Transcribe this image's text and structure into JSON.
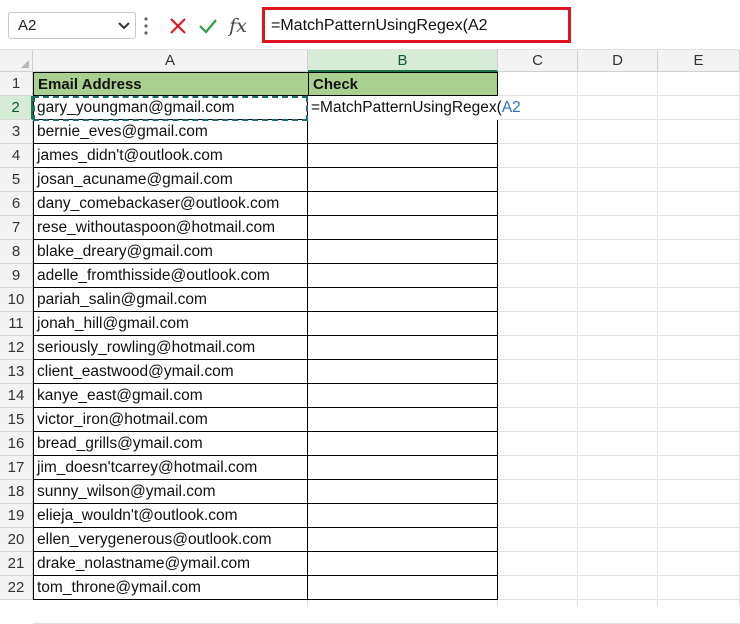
{
  "formula_bar": {
    "name_box": "A2",
    "formula": "=MatchPatternUsingRegex(A2",
    "fx_label": "fx"
  },
  "columns": [
    "A",
    "B",
    "C",
    "D",
    "E"
  ],
  "rows": [
    "1",
    "2",
    "3",
    "4",
    "5",
    "6",
    "7",
    "8",
    "9",
    "10",
    "11",
    "12",
    "13",
    "14",
    "15",
    "16",
    "17",
    "18",
    "19",
    "20",
    "21",
    "22"
  ],
  "table": {
    "header_a": "Email Address",
    "header_b": "Check",
    "emails": [
      "gary_youngman@gmail.com",
      "bernie_eves@gmail.com",
      "james_didn't@outlook.com",
      "josan_acuname@gmail.com",
      "dany_comebackaser@outlook.com",
      "rese_withoutaspoon@hotmail.com",
      "blake_dreary@gmail.com",
      "adelle_fromthisside@outlook.com",
      "pariah_salin@gmail.com",
      "jonah_hill@gmail.com",
      "seriously_rowling@hotmail.com",
      "client_eastwood@ymail.com",
      "kanye_east@gmail.com",
      "victor_iron@hotmail.com",
      "bread_grills@ymail.com",
      "jim_doesn'tcarrey@hotmail.com",
      "sunny_wilson@ymail.com",
      "elieja_wouldn't@outlook.com",
      "ellen_verygenerous@outlook.com",
      "drake_nolastname@ymail.com",
      "tom_throne@ymail.com"
    ]
  },
  "editing_cell": {
    "text_prefix": "=MatchPatternUsingRegex(",
    "ref": "A2"
  },
  "colors": {
    "header_fill": "#a9d08e",
    "highlight_border": "#e0141e",
    "reference_blue": "#2f6fc7",
    "selection_green": "#217346"
  }
}
